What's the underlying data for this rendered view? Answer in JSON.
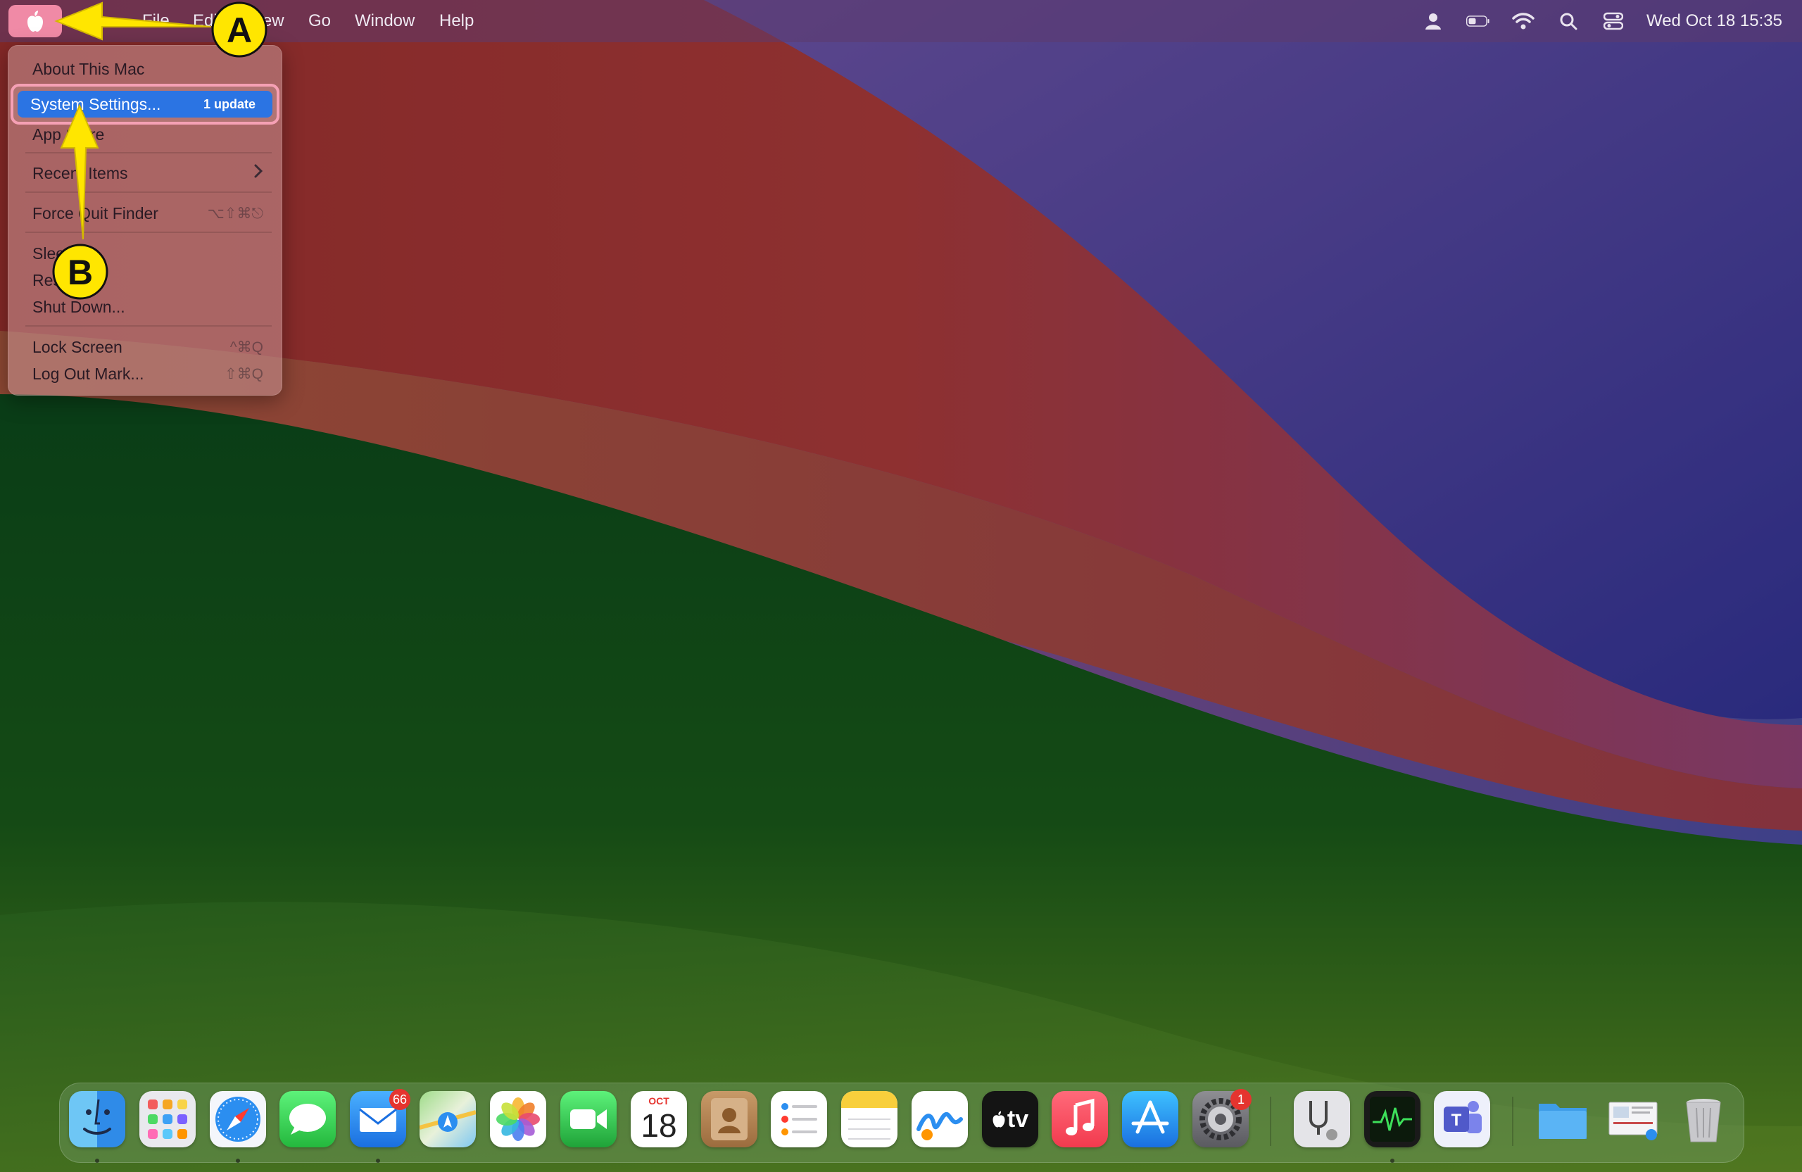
{
  "menubar": {
    "menus": [
      "File",
      "Edit",
      "View",
      "Go",
      "Window",
      "Help"
    ],
    "clock": "Wed Oct 18  15:35",
    "status_icons": [
      "user-icon",
      "battery-icon",
      "wifi-icon",
      "spotlight-search-icon",
      "control-center-icon"
    ]
  },
  "apple_menu": {
    "about": "About This Mac",
    "system_settings": "System Settings...",
    "system_settings_badge": "1 update",
    "app_store": "App Store",
    "recent_items": "Recent Items",
    "force_quit": "Force Quit Finder",
    "force_quit_shortcut": "⌥⇧⌘⎋",
    "sleep": "Sleep",
    "restart": "Restart...",
    "shut_down": "Shut Down...",
    "lock_screen": "Lock Screen",
    "lock_screen_shortcut": "^⌘Q",
    "log_out": "Log Out Mark...",
    "log_out_shortcut": "⇧⌘Q"
  },
  "annotations": {
    "a": "A",
    "b": "B",
    "color": "#ffe600"
  },
  "dock": {
    "apps": [
      "Finder",
      "Launchpad",
      "Safari",
      "Messages",
      "Mail",
      "Maps",
      "Photos",
      "FaceTime",
      "Calendar",
      "Contacts",
      "Reminders",
      "Notes",
      "Freeform",
      "TV",
      "Music",
      "App Store",
      "System Settings",
      "Disk Utility",
      "Activity Monitor",
      "Microsoft Teams",
      "Downloads",
      "Preview",
      "Trash"
    ],
    "mail_badge": "66",
    "settings_badge": "1",
    "calendar_month": "OCT",
    "calendar_day": "18",
    "tv_label": "tv"
  }
}
